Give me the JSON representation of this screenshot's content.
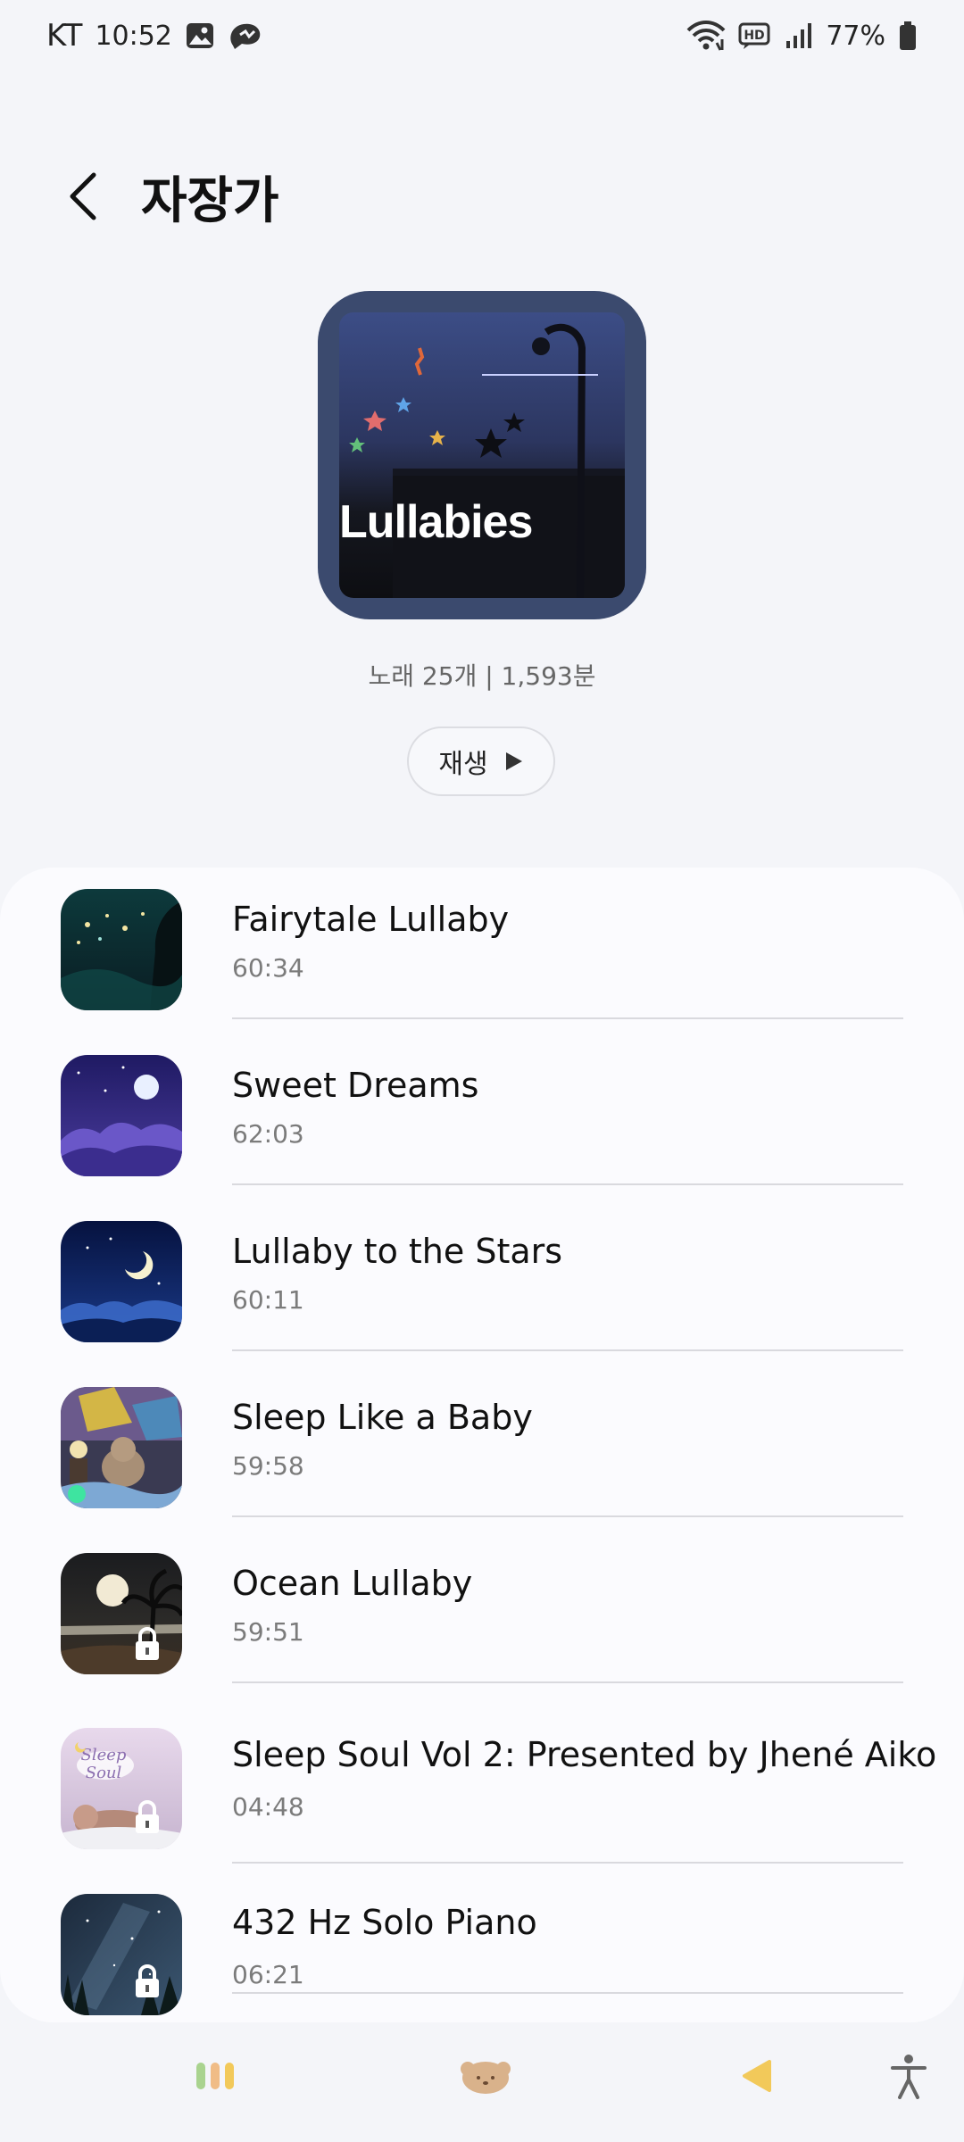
{
  "status_bar": {
    "carrier": "KT",
    "time": "10:52",
    "battery": "77%",
    "icons": [
      "gallery-icon",
      "messenger-icon",
      "wifi-icon",
      "hd-voice-icon",
      "signal-icon",
      "battery-icon"
    ]
  },
  "header": {
    "title": "자장가",
    "back_icon": "back-arrow-icon"
  },
  "playlist": {
    "cover_text": "Lullabies",
    "meta": "노래 25개 | 1,593분",
    "play_label": "재생",
    "play_icon": "play-icon"
  },
  "songs": [
    {
      "title": "Fairytale Lullaby",
      "duration": "60:34",
      "locked": false
    },
    {
      "title": "Sweet Dreams",
      "duration": "62:03",
      "locked": false
    },
    {
      "title": "Lullaby to the Stars",
      "duration": "60:11",
      "locked": false
    },
    {
      "title": "Sleep Like a Baby",
      "duration": "59:58",
      "locked": false
    },
    {
      "title": "Ocean Lullaby",
      "duration": "59:51",
      "locked": true
    },
    {
      "title": "Sleep Soul Vol 2: Presented by Jhené Aiko",
      "duration": "04:48",
      "locked": true
    },
    {
      "title": "432 Hz Solo Piano",
      "duration": "06:21",
      "locked": true
    }
  ],
  "bottom_nav": {
    "items": [
      "sounds-nav-icon",
      "character-nav-icon",
      "back-nav-icon",
      "accessibility-icon"
    ]
  },
  "colors": {
    "background": "#f4f5f9",
    "list_background": "#fbfbfe",
    "cover_frame": "#3b4a6e",
    "text_primary": "#111111",
    "text_secondary": "#7b7b7b",
    "accent_yellow": "#f2c95a"
  }
}
